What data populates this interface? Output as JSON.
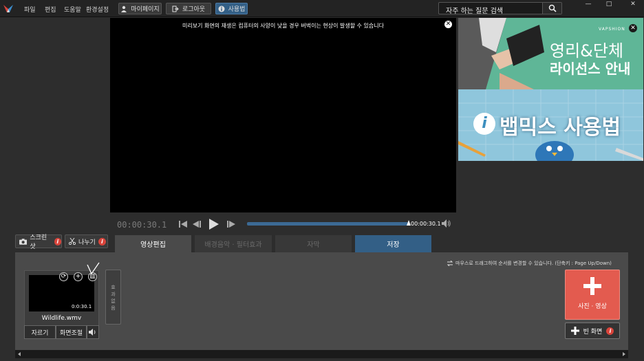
{
  "menu": [
    "파일",
    "편집",
    "도움말",
    "환경설정"
  ],
  "top_buttons": {
    "mypage": "마이페이지",
    "logout": "로그아웃",
    "howto": "사용법"
  },
  "search": {
    "value": "자주 하는 질문 검색"
  },
  "window_controls": {
    "minimize": "—",
    "maximize": "□",
    "close": "✕"
  },
  "preview": {
    "notice": "미리보기 화면의 재생은 컴퓨터의 사양이 낮을 경우 버벅이는 현상이 발생할 수 있습니다",
    "close": "✕"
  },
  "ads": {
    "ad1": {
      "brand": "VAPSHION",
      "line1": "영리&단체",
      "line2": "라이선스 안내",
      "close": "✕"
    },
    "ad2": {
      "title": "뱁믹스 사용법",
      "info": "i"
    }
  },
  "player": {
    "current_time": "00:00:30.1",
    "end_time": "00:00:30.1",
    "progress": 1.0
  },
  "side_buttons": {
    "screenshot": "스크린샷",
    "split": "나누기",
    "badge": "i"
  },
  "tabs": [
    {
      "label": "영상편집",
      "state": "active"
    },
    {
      "label": "배경음악 · 필터효과",
      "state": "disabled"
    },
    {
      "label": "자막",
      "state": "disabled"
    },
    {
      "label": "저장",
      "state": "highlight"
    }
  ],
  "hint": "마우스로 드래그하여 순서를 변경할 수 있습니다. (단축키 : Page Up/Down)",
  "clip": {
    "time": "0:0:30.1",
    "name": "Wildlife.wmv",
    "cut": "자르기",
    "adjust": "화면조절"
  },
  "effect": {
    "label": "효과없음"
  },
  "add_media": {
    "label": "사진 · 영상"
  },
  "blank": {
    "label": "빈 화면",
    "badge": "i"
  },
  "colors": {
    "accent": "#335f86",
    "add": "#e35b4f",
    "badge": "#d9443b"
  }
}
